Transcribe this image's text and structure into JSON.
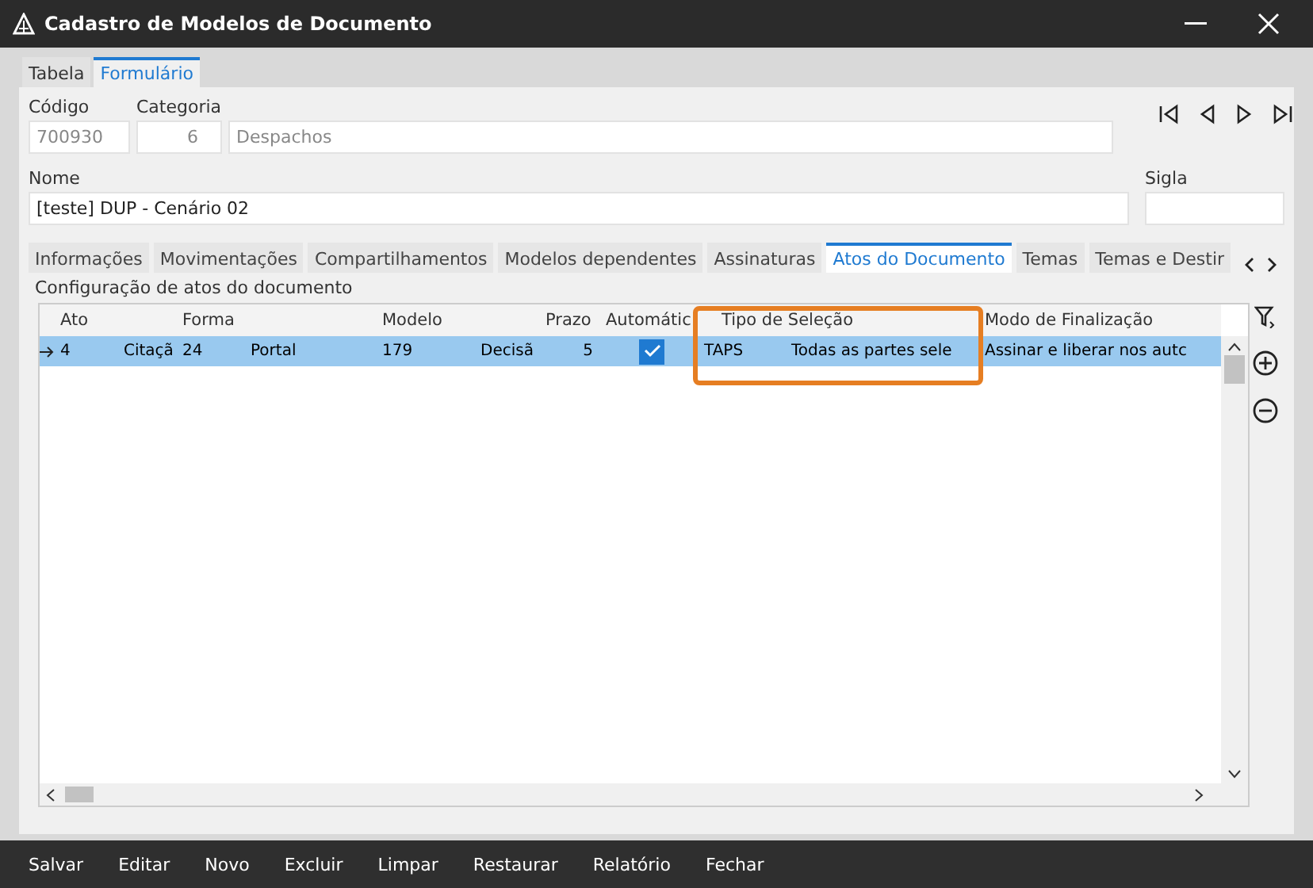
{
  "window": {
    "title": "Cadastro de Modelos de Documento"
  },
  "tabs": [
    {
      "label": "Tabela",
      "selected": false
    },
    {
      "label": "Formulário",
      "selected": true
    }
  ],
  "form": {
    "codigo": {
      "label": "Código",
      "value": "700930",
      "disabled": true
    },
    "categoria": {
      "label": "Categoria",
      "number": "6",
      "value": "Despachos",
      "disabled": true
    },
    "nome": {
      "label": "Nome",
      "value": "[teste] DUP - Cenário 02"
    },
    "sigla": {
      "label": "Sigla"
    }
  },
  "sub_tabs": [
    {
      "label": "Informações",
      "selected": false
    },
    {
      "label": "Movimentações",
      "selected": false
    },
    {
      "label": "Compartilhamentos",
      "selected": false
    },
    {
      "label": "Modelos dependentes",
      "selected": false
    },
    {
      "label": "Assinaturas",
      "selected": false
    },
    {
      "label": "Atos do Documento",
      "selected": true
    },
    {
      "label": "Temas",
      "selected": false
    },
    {
      "label": "Temas e Destir",
      "selected": false
    }
  ],
  "section_title": "Configuração de atos do documento",
  "table": {
    "columns": [
      "Ato",
      "Forma",
      "Modelo",
      "Prazo",
      "Automátic",
      "Tipo de Seleção",
      "Modo de Finalização"
    ],
    "rows": [
      {
        "selected": true,
        "cells": [
          {
            "kind": "pair",
            "code": "4",
            "text": "Citaçã"
          },
          {
            "kind": "pair",
            "code": "24",
            "text": "Portal"
          },
          {
            "kind": "pair",
            "code": "179",
            "text": "Decisã"
          },
          {
            "kind": "number",
            "text": "5"
          },
          {
            "kind": "check",
            "checked": true
          },
          {
            "kind": "pair",
            "code": "TAPS",
            "text": "Todas as partes sele"
          },
          {
            "kind": "text",
            "text": "Assinar e liberar nos autc"
          }
        ]
      }
    ]
  },
  "actions": [
    "Salvar",
    "Editar",
    "Novo",
    "Excluir",
    "Limpar",
    "Restaurar",
    "Relatório",
    "Fechar"
  ]
}
